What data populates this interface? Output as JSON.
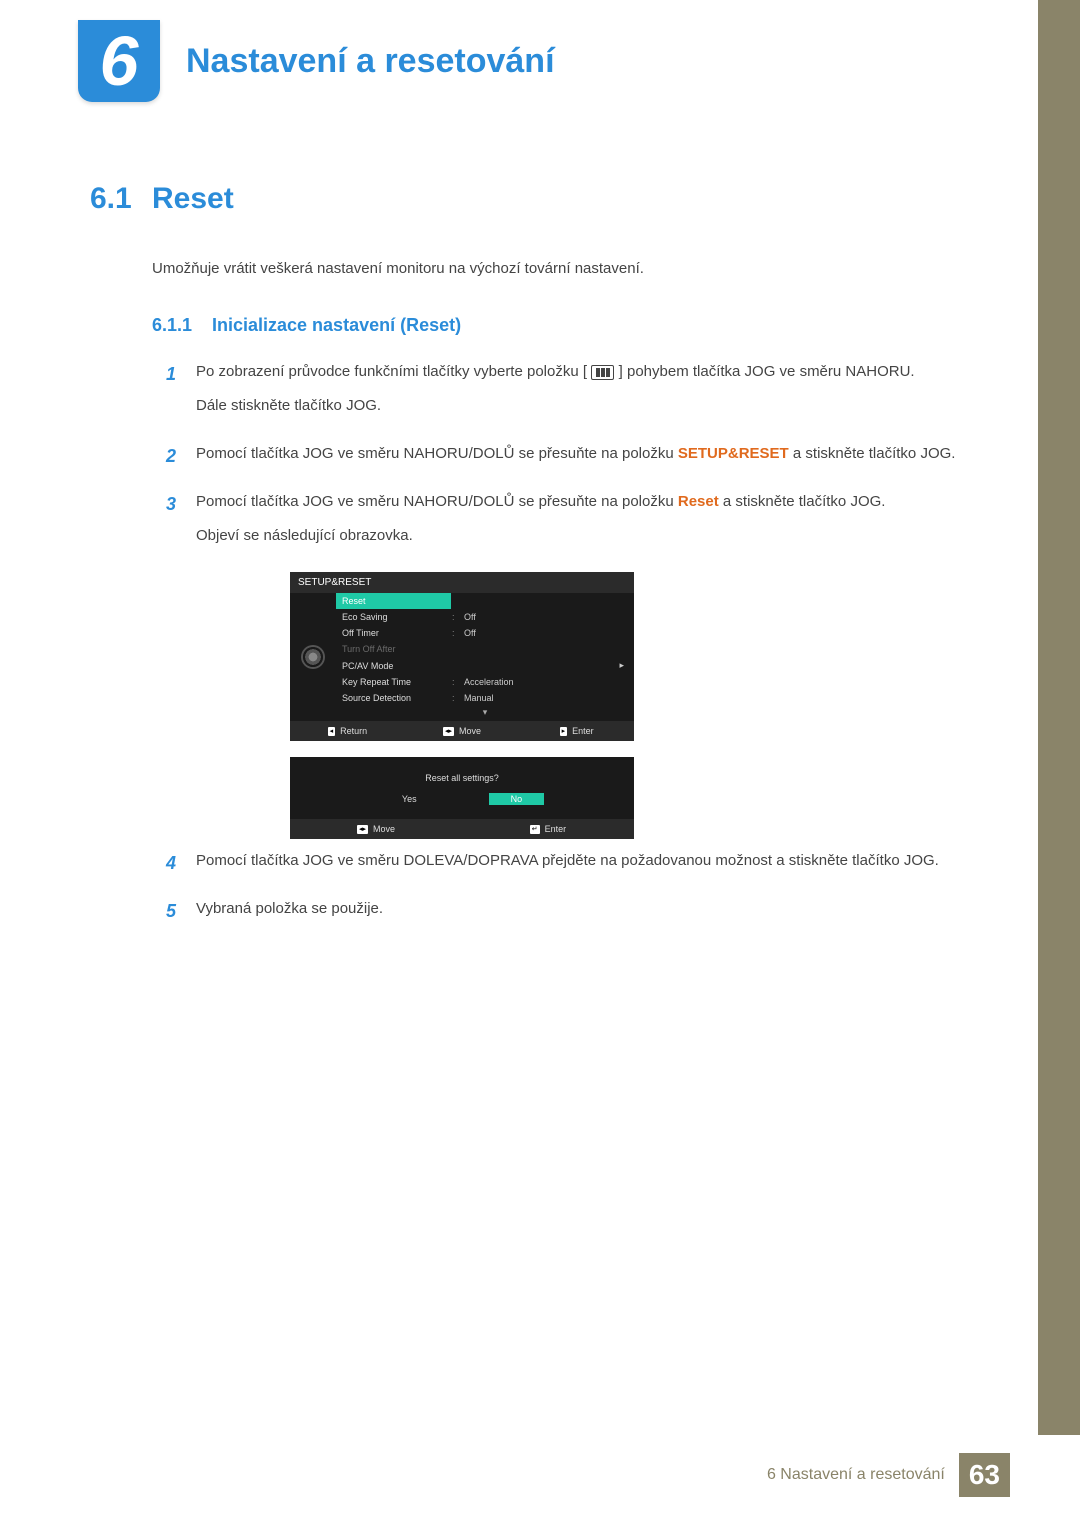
{
  "chapter": {
    "number": "6",
    "title": "Nastavení a resetování"
  },
  "section": {
    "number": "6.1",
    "title": "Reset",
    "intro": "Umožňuje vrátit veškerá nastavení monitoru na výchozí tovární nastavení."
  },
  "subsection": {
    "number": "6.1.1",
    "title": "Inicializace nastavení (Reset)"
  },
  "steps": {
    "s1": {
      "num": "1",
      "p1a": "Po zobrazení průvodce funkčními tlačítky vyberte položku [",
      "p1b": "] pohybem tlačítka JOG ve směru NAHORU.",
      "p2": "Dále stiskněte tlačítko JOG."
    },
    "s2": {
      "num": "2",
      "p1a": "Pomocí tlačítka JOG ve směru NAHORU/DOLŮ se přesuňte na položku ",
      "emph": "SETUP&RESET",
      "p1b": " a stiskněte tlačítko JOG."
    },
    "s3": {
      "num": "3",
      "p1a": "Pomocí tlačítka JOG ve směru NAHORU/DOLŮ se přesuňte na položku ",
      "emph": "Reset",
      "p1b": " a stiskněte tlačítko JOG.",
      "p2": "Objeví se následující obrazovka."
    },
    "s4": {
      "num": "4",
      "p1": "Pomocí tlačítka JOG ve směru DOLEVA/DOPRAVA přejděte na požadovanou možnost a stiskněte tlačítko JOG."
    },
    "s5": {
      "num": "5",
      "p1": "Vybraná položka se použije."
    }
  },
  "osd": {
    "title": "SETUP&RESET",
    "rows": {
      "reset": "Reset",
      "eco_label": "Eco Saving",
      "eco_val": "Off",
      "offtimer_label": "Off Timer",
      "offtimer_val": "Off",
      "turnoff_label": "Turn Off After",
      "pcav_label": "PC/AV Mode",
      "keyrep_label": "Key Repeat Time",
      "keyrep_val": "Acceleration",
      "srcdet_label": "Source Detection",
      "srcdet_val": "Manual"
    },
    "footer": {
      "return": "Return",
      "move": "Move",
      "enter": "Enter"
    }
  },
  "osd2": {
    "question": "Reset all settings?",
    "yes": "Yes",
    "no": "No",
    "move": "Move",
    "enter": "Enter"
  },
  "footer": {
    "text": "6 Nastavení a resetování",
    "page": "63"
  }
}
